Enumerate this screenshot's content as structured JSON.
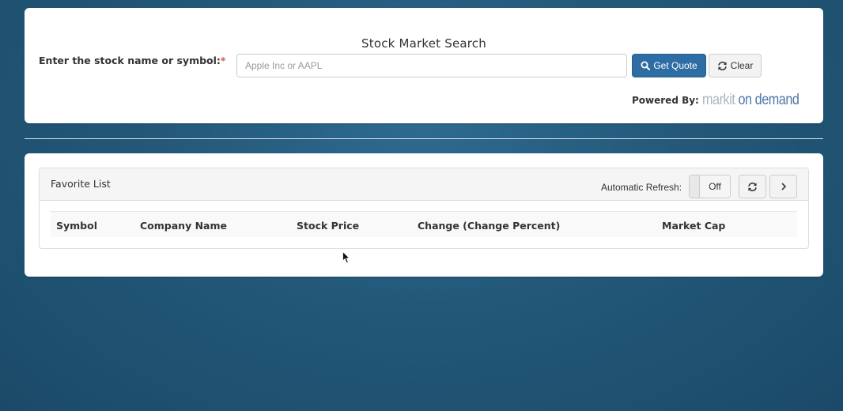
{
  "search": {
    "title": "Stock Market Search",
    "label": "Enter the stock name or symbol:",
    "required_marker": "*",
    "placeholder": "Apple Inc or AAPL",
    "value": "",
    "get_quote_label": "Get Quote",
    "clear_label": "Clear",
    "powered_by_label": "Powered By:",
    "logo_text_part1": "markit",
    "logo_text_part2": " on demand"
  },
  "favorites": {
    "title": "Favorite List",
    "auto_refresh_label": "Automatic Refresh:",
    "toggle_state": "Off",
    "columns": [
      "Symbol",
      "Company Name",
      "Stock Price",
      "Change (Change Percent)",
      "Market Cap"
    ],
    "rows": []
  },
  "colors": {
    "primary": "#2e6da4",
    "required": "#d9534f",
    "background": "#235879"
  },
  "icons": {
    "search": "search-icon",
    "clear": "refresh-icon",
    "refresh": "refresh-icon",
    "next": "chevron-right-icon"
  }
}
